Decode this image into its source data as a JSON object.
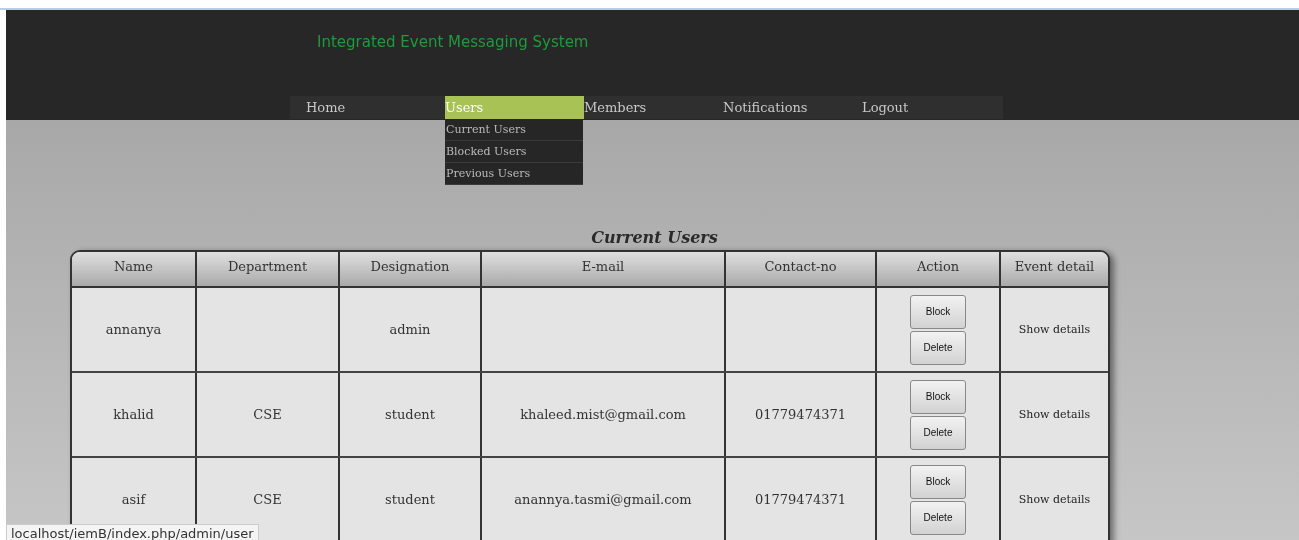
{
  "site_title": "Integrated Event Messaging System",
  "nav": [
    {
      "label": "Home",
      "selected": false
    },
    {
      "label": "Users",
      "selected": true,
      "submenu": [
        "Current Users",
        "Blocked Users",
        "Previous Users"
      ]
    },
    {
      "label": "Members",
      "selected": false
    },
    {
      "label": "Notifications",
      "selected": false
    },
    {
      "label": "Logout",
      "selected": false
    }
  ],
  "page_title": "Current Users",
  "table": {
    "columns": [
      "Name",
      "Department",
      "Designation",
      "E-mail",
      "Contact-no",
      "Action",
      "Event detail"
    ],
    "rows": [
      {
        "name": "annanya",
        "department": "",
        "designation": "admin",
        "email": "",
        "contact": "",
        "actions": [
          "Block",
          "Delete"
        ],
        "detail": "Show details"
      },
      {
        "name": "khalid",
        "department": "CSE",
        "designation": "student",
        "email": "khaleed.mist@gmail.com",
        "contact": "01779474371",
        "actions": [
          "Block",
          "Delete"
        ],
        "detail": "Show details"
      },
      {
        "name": "asif",
        "department": "CSE",
        "designation": "student",
        "email": "anannya.tasmi@gmail.com",
        "contact": "01779474371",
        "actions": [
          "Block",
          "Delete"
        ],
        "detail": "Show details"
      }
    ]
  },
  "status_bar": "localhost/iemB/index.php/admin/user"
}
